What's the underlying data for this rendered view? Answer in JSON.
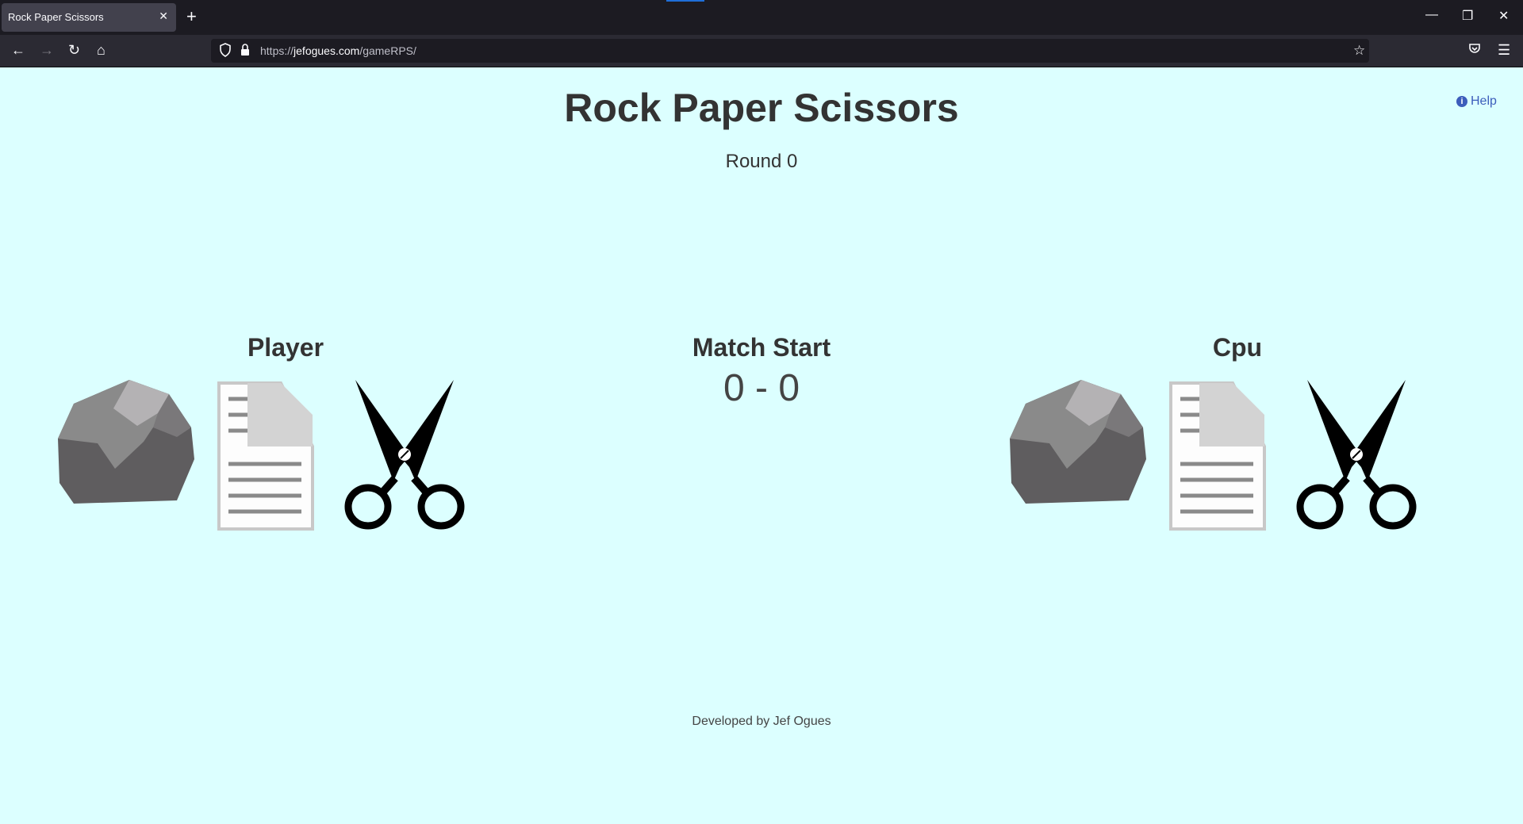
{
  "browser": {
    "tab_title": "Rock Paper Scissors",
    "tab_close": "✕",
    "new_tab": "+",
    "url_scheme": "https://",
    "url_host": "jefogues.com",
    "url_path": "/gameRPS/"
  },
  "game": {
    "title": "Rock Paper Scissors",
    "round": "Round 0",
    "help": "Help",
    "player_label": "Player",
    "cpu_label": "Cpu",
    "status": "Match Start",
    "score": "0 - 0",
    "footer": "Developed by Jef Ogues"
  },
  "colors": {
    "page_background": "#dcffff",
    "link": "#3c5dbb",
    "text": "#333333"
  }
}
